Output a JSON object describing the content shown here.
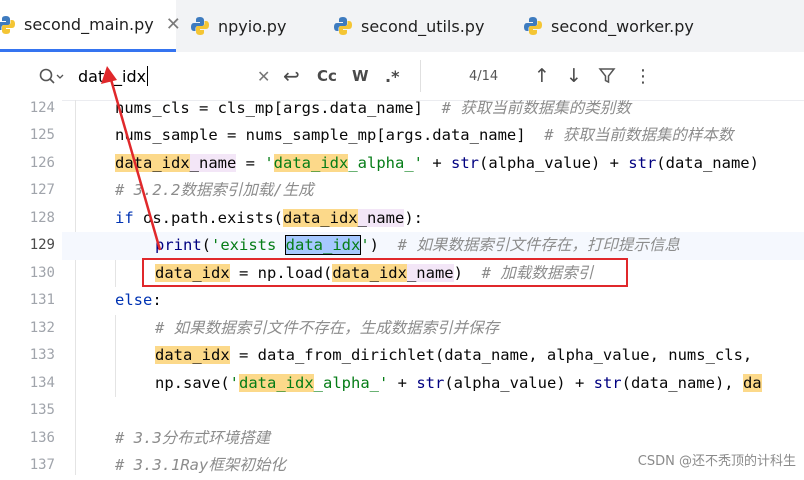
{
  "tabs": [
    {
      "label": "second_main.py",
      "active": true,
      "close": "✕"
    },
    {
      "label": "npyio.py"
    },
    {
      "label": "second_utils.py"
    },
    {
      "label": "second_worker.py"
    }
  ],
  "search": {
    "query": "data_idx",
    "match_count": "4/14",
    "buttons": {
      "clear": "✕",
      "regex_return": "↩",
      "case": "Cc",
      "words": "W",
      "regex": ".*",
      "prev": "↑",
      "next": "↓",
      "filter": "⛉",
      "more": "⋮"
    }
  },
  "line_numbers": [
    "124",
    "125",
    "126",
    "127",
    "128",
    "129",
    "130",
    "131",
    "132",
    "133",
    "134",
    "135",
    "136",
    "137"
  ],
  "current_line": "129",
  "code": {
    "l124": {
      "a": "nums_cls = cls_mp[args.data_name]  ",
      "c": "# 获取当前数据集的类别数"
    },
    "l125": {
      "a": "nums_sample = nums_sample_mp[args.data_name]  ",
      "c": "# 获取当前数据集的样本数"
    },
    "l126": {
      "v1": "data_idx",
      "v2": "_name",
      "eq": " = ",
      "s1": "'",
      "s2": "data_idx",
      "s3": "_alpha_'",
      "plus": " + ",
      "f1": "str",
      "rest": "(alpha_value) + ",
      "f2": "str",
      "rest2": "(data_name)"
    },
    "l127": {
      "c": "# 3.2.2数据索引加载/生成"
    },
    "l128": {
      "kw": "if",
      "a": " os.path.exists(",
      "v1": "data_idx",
      "v2": "_name",
      "b": "):"
    },
    "l129": {
      "f": "print",
      "p": "(",
      "s1": "'exists ",
      "s2": "data_idx",
      "s3": "'",
      "p2": ")  ",
      "c": "# 如果数据索引文件存在，打印提示信息"
    },
    "l130": {
      "v": "data_idx",
      "a": " = np.load(",
      "v1": "data_idx",
      "v2": "_name",
      "b": ")  ",
      "c": "# 加载数据索引"
    },
    "l131": {
      "kw": "else",
      "a": ":"
    },
    "l132": {
      "c": "# 如果数据索引文件不存在，生成数据索引并保存"
    },
    "l133": {
      "v": "data_idx",
      "a": " = data_from_dirichlet(data_name, alpha_value, nums_cls, "
    },
    "l134": {
      "a": "np.save(",
      "s1": "'",
      "s2": "data_idx",
      "s3": "_alpha_'",
      "plus": " + ",
      "f1": "str",
      "rest": "(alpha_value) + ",
      "f2": "str",
      "rest2": "(data_name), ",
      "tail": "da"
    },
    "l136": {
      "c": "# 3.3分布式环境搭建"
    },
    "l137": {
      "c": "# 3.3.1Ray框架初始化"
    }
  },
  "watermark": "CSDN @还不秃顶的计科生",
  "colors": {
    "accent": "#3574f0",
    "annotation": "#e0282b",
    "match_highlight": "#fcd98a",
    "selection": "#a6c8ff"
  }
}
